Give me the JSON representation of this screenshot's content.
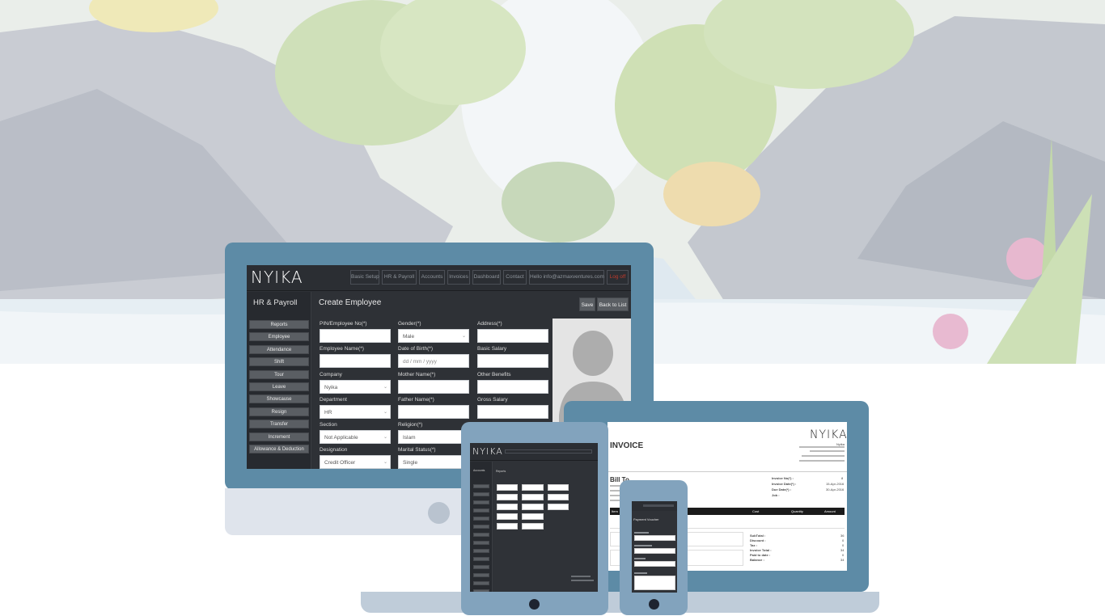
{
  "scene": {
    "description_none": ""
  },
  "desktop": {
    "logo": "NYIKA",
    "nav": [
      "Basic Setup",
      "HR & Payroll",
      "Accounts",
      "Invoices",
      "Dashboard",
      "Contact",
      "Hello info@azmaxventures.com",
      "Log off"
    ],
    "sidebar_title": "HR & Payroll",
    "sidebar_items": [
      "Reports",
      "Employee",
      "Attendance",
      "Shift",
      "Tour",
      "Leave",
      "Showcause",
      "Resign",
      "Transfer",
      "Increment",
      "Allowance & Deduction"
    ],
    "form_title": "Create Employee",
    "save_label": "Save",
    "back_label": "Back to List",
    "fields": {
      "pin": {
        "label": "PIN/Employee No(*)",
        "value": ""
      },
      "gender": {
        "label": "Gender(*)",
        "value": "Male"
      },
      "address": {
        "label": "Address(*)",
        "value": ""
      },
      "name": {
        "label": "Employee Name(*)",
        "value": ""
      },
      "dob": {
        "label": "Date of Birth(*)",
        "value": "dd / mm / yyyy"
      },
      "basic_salary": {
        "label": "Basic Salary",
        "value": ""
      },
      "company": {
        "label": "Company",
        "value": "Nyika"
      },
      "mother": {
        "label": "Mother Name(*)",
        "value": ""
      },
      "other_benefits": {
        "label": "Other Benefits",
        "value": ""
      },
      "department": {
        "label": "Department",
        "value": "HR"
      },
      "father": {
        "label": "Father Name(*)",
        "value": ""
      },
      "gross_salary": {
        "label": "Gross Salary",
        "value": ""
      },
      "section": {
        "label": "Section",
        "value": "Not Applicable"
      },
      "religion": {
        "label": "Religion(*)",
        "value": "Islam"
      },
      "designation": {
        "label": "Designation",
        "value": "Credit Officer"
      },
      "marital": {
        "label": "Marital Status(*)",
        "value": "Single"
      }
    }
  },
  "laptop": {
    "title": "INVOICE",
    "logo": "NYIKA",
    "company": "Nyika",
    "bill_to": "Bill To",
    "invoice_meta": [
      {
        "label": "Invoice No(*) :",
        "value": "8"
      },
      {
        "label": "Invoice Date(*) :",
        "value": "15-Apr-2016"
      },
      {
        "label": "Due Date(*) :",
        "value": "30-Apr-2016"
      },
      {
        "label": "Job :",
        "value": ""
      }
    ],
    "columns": [
      "Item",
      "Cost",
      "Quantity",
      "Amount"
    ],
    "totals": [
      {
        "label": "SubTotal :",
        "value": "36"
      },
      {
        "label": "Discount :",
        "value": "0"
      },
      {
        "label": "Tax :",
        "value": "0"
      },
      {
        "label": "Invoice Total :",
        "value": "34"
      },
      {
        "label": "Paid to date :",
        "value": "0"
      },
      {
        "label": "Balance :",
        "value": "34"
      }
    ]
  },
  "tablet": {
    "logo": "NYIKA",
    "sidebar_title": "Accounts",
    "main_title": "Reports"
  },
  "phone": {
    "title": "Payment Voucher"
  }
}
